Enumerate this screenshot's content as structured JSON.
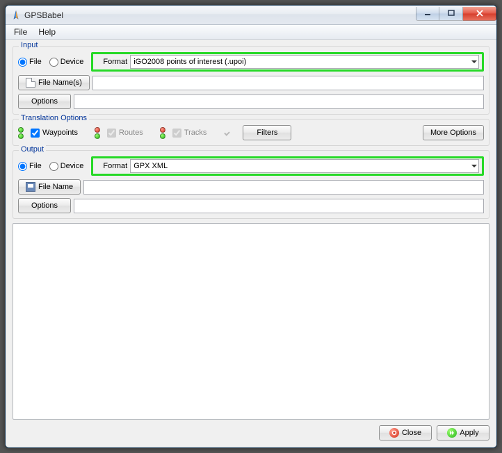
{
  "window": {
    "title": "GPSBabel"
  },
  "menu": {
    "file": "File",
    "help": "Help"
  },
  "input": {
    "legend": "Input",
    "file_radio": "File",
    "device_radio": "Device",
    "format_label": "Format",
    "format_value": "iGO2008 points of interest (.upoi)",
    "filenames_btn": "File Name(s)",
    "options_btn": "Options"
  },
  "trans": {
    "legend": "Translation Options",
    "waypoints": "Waypoints",
    "routes": "Routes",
    "tracks": "Tracks",
    "filters_btn": "Filters",
    "more_btn": "More Options"
  },
  "output": {
    "legend": "Output",
    "file_radio": "File",
    "device_radio": "Device",
    "format_label": "Format",
    "format_value": "GPX XML",
    "filename_btn": "File Name",
    "options_btn": "Options"
  },
  "footer": {
    "close": "Close",
    "apply": "Apply"
  }
}
